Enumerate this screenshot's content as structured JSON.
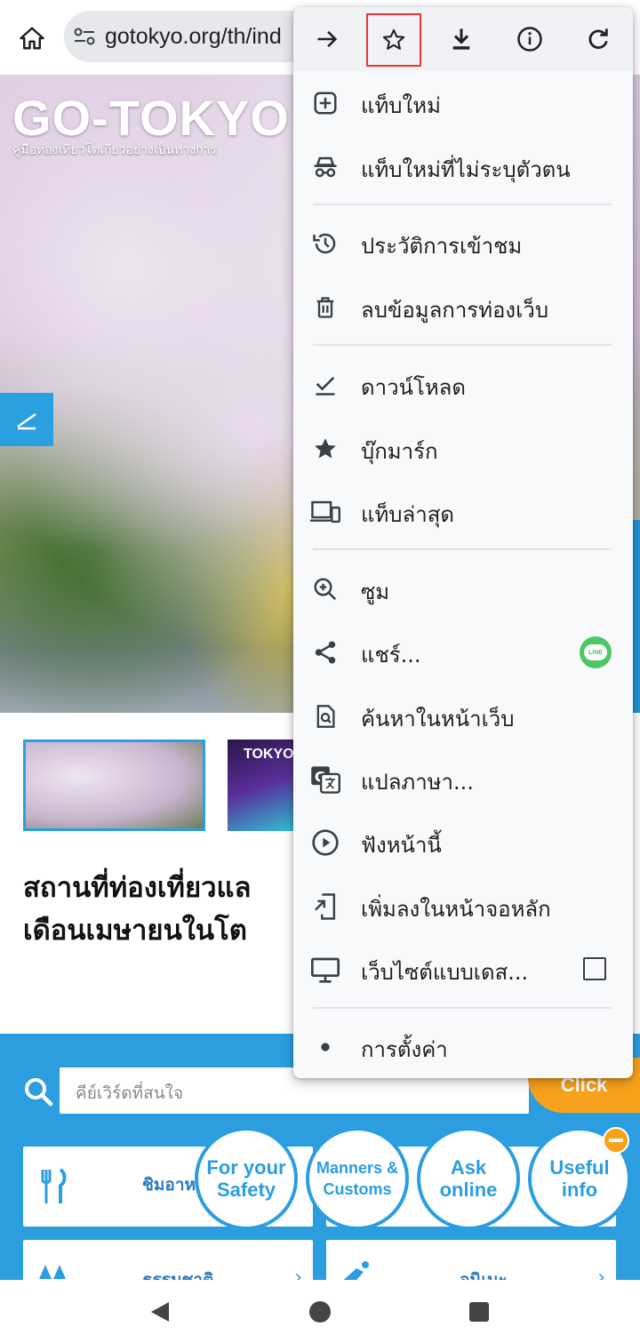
{
  "browser": {
    "url": "gotokyo.org/th/ind"
  },
  "page": {
    "logo": "GO-TOKYO",
    "tagline": "คู่มือท่องเที่ยวโตเกียวอย่างเป็นทางการ",
    "thumb2_label": "TOKYO",
    "headline_line1": "สถานที่ท่องเที่ยวแล",
    "headline_line2": "เดือนเมษายนในโต",
    "search_placeholder": "คีย์เวิร์ดที่สนใจ",
    "click_label": "Click",
    "categories": [
      {
        "label": "ชิมอาหาร",
        "icon": "fork-knife-icon"
      },
      {
        "label": "",
        "icon": ""
      },
      {
        "label": "ธรรมชาติ",
        "icon": "tree-icon"
      },
      {
        "label": "อนิเมะ",
        "icon": "anime-icon"
      }
    ],
    "circles": [
      {
        "line1": "For your",
        "line2": "Safety"
      },
      {
        "line1": "Manners &",
        "line2": "Customs"
      },
      {
        "line1": "Ask",
        "line2": "online"
      },
      {
        "line1": "Useful",
        "line2": "info"
      }
    ]
  },
  "menu": {
    "toolbar": [
      "forward-icon",
      "star-outline-icon",
      "download-icon",
      "info-icon",
      "refresh-icon"
    ],
    "items": [
      {
        "label": "แท็บใหม่",
        "icon": "new-tab-icon"
      },
      {
        "label": "แท็บใหม่ที่ไม่ระบุตัวตน",
        "icon": "incognito-icon"
      },
      {
        "label": "ประวัติการเข้าชม",
        "icon": "history-icon"
      },
      {
        "label": "ลบข้อมูลการท่องเว็บ",
        "icon": "trash-icon"
      },
      {
        "label": "ดาวน์โหลด",
        "icon": "download-check-icon"
      },
      {
        "label": "บุ๊กมาร์ก",
        "icon": "star-filled-icon"
      },
      {
        "label": "แท็บล่าสุด",
        "icon": "devices-icon"
      },
      {
        "label": "ซูม",
        "icon": "zoom-icon"
      },
      {
        "label": "แชร์...",
        "icon": "share-icon",
        "badge": "LINE"
      },
      {
        "label": "ค้นหาในหน้าเว็บ",
        "icon": "find-in-page-icon"
      },
      {
        "label": "แปลภาษา...",
        "icon": "translate-icon"
      },
      {
        "label": "ฟังหน้านี้",
        "icon": "play-circle-icon"
      },
      {
        "label": "เพิ่มลงในหน้าจอหลัก",
        "icon": "add-to-home-icon"
      },
      {
        "label": "เว็บไซต์แบบเดส...",
        "icon": "desktop-icon",
        "checked": false
      },
      {
        "label": "การตั้งค่า",
        "icon": "gear-icon"
      }
    ]
  },
  "colors": {
    "accent_blue": "#2c9ee0",
    "click_orange": "#f8a21b",
    "highlight_red": "#e53935",
    "line_green": "#4cc764"
  }
}
